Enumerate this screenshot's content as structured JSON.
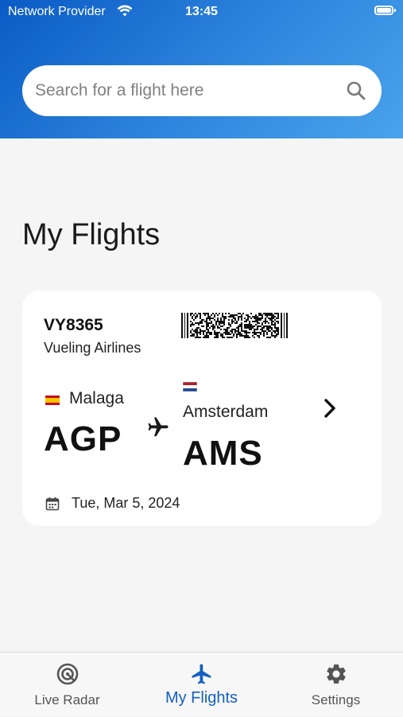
{
  "status_bar": {
    "carrier": "Network Provider",
    "time": "13:45"
  },
  "search": {
    "placeholder": "Search for a flight here"
  },
  "page": {
    "title": "My Flights"
  },
  "flight_card": {
    "flight_number": "VY8365",
    "airline": "Vueling Airlines",
    "from": {
      "city": "Malaga",
      "code": "AGP"
    },
    "to": {
      "city": "Amsterdam",
      "code": "AMS"
    },
    "date": "Tue, Mar 5, 2024"
  },
  "tabs": [
    {
      "label": "Live Radar",
      "icon": "radar-icon",
      "active": false
    },
    {
      "label": "My Flights",
      "icon": "airplane-icon",
      "active": true
    },
    {
      "label": "Settings",
      "icon": "gear-icon",
      "active": false
    }
  ],
  "colors": {
    "accent": "#1560c0",
    "header_start": "#0a5bc4",
    "header_end": "#4aa3ec",
    "background": "#f5f5f5"
  }
}
